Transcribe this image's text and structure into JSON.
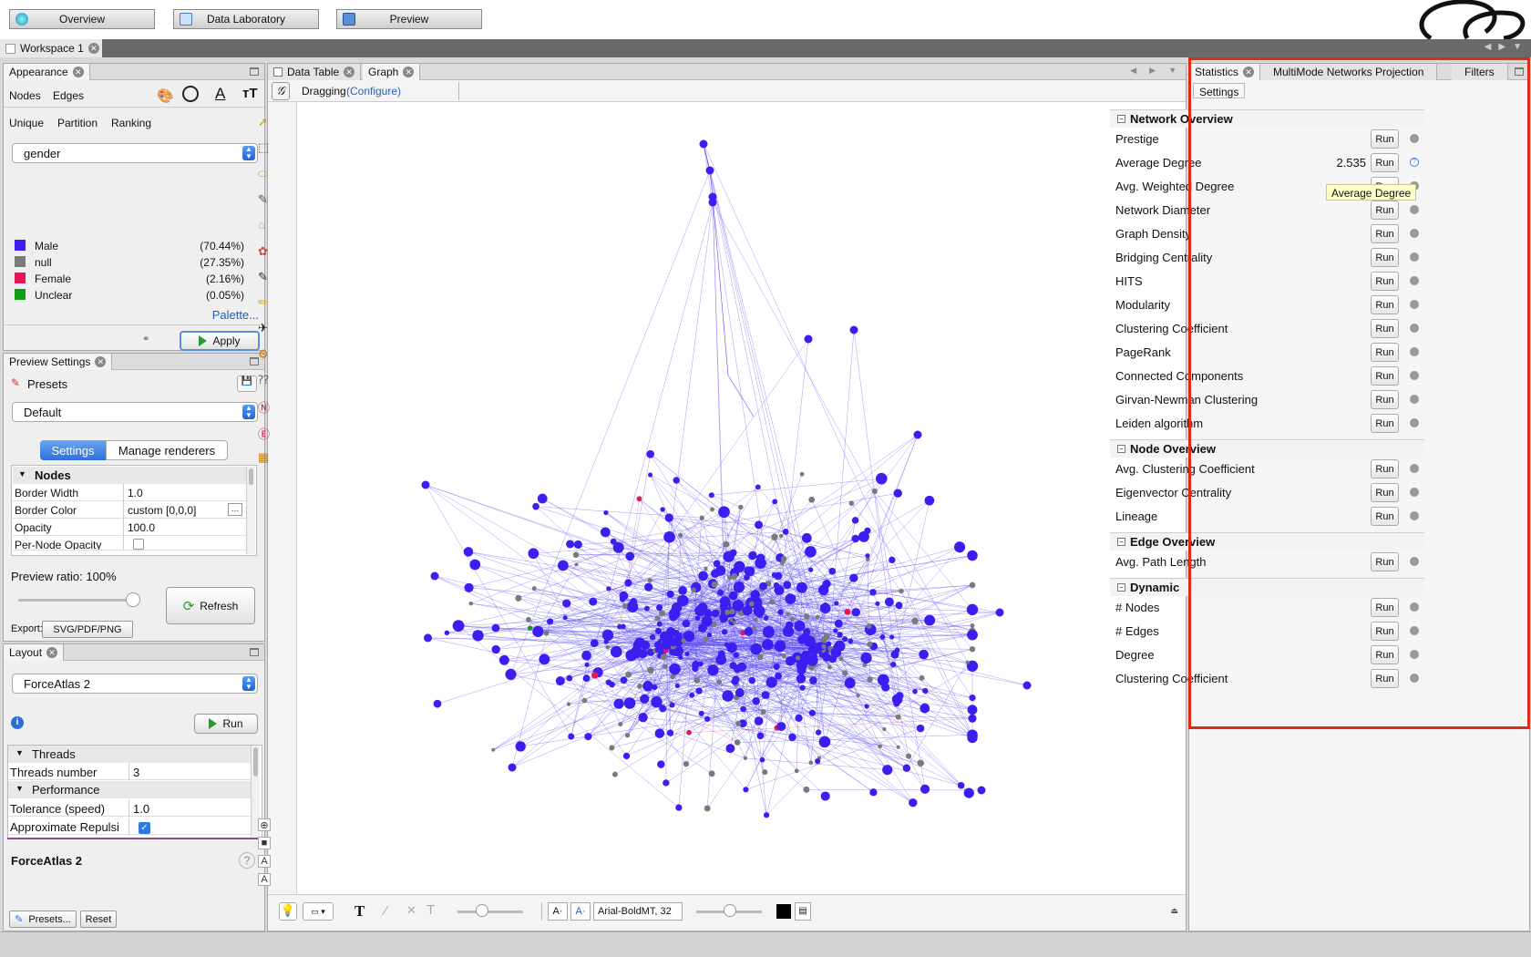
{
  "topbar": {
    "overview": "Overview",
    "data_lab": "Data Laboratory",
    "preview": "Preview"
  },
  "workspace": {
    "tab": "Workspace 1"
  },
  "appearance": {
    "title": "Appearance",
    "nodes": "Nodes",
    "edges": "Edges",
    "modes": [
      "Unique",
      "Partition",
      "Ranking"
    ],
    "attribute": "gender",
    "legend": [
      {
        "label": "Male",
        "pct": "(70.44%)",
        "color": "#3b1ff0"
      },
      {
        "label": "null",
        "pct": "(27.35%)",
        "color": "#7a7a7a"
      },
      {
        "label": "Female",
        "pct": "(2.16%)",
        "color": "#e8145a"
      },
      {
        "label": "Unclear",
        "pct": "(0.05%)",
        "color": "#12a012"
      }
    ],
    "palette": "Palette...",
    "apply": "Apply"
  },
  "preview_settings": {
    "title": "Preview Settings",
    "presets": "Presets",
    "preset_value": "Default",
    "tab_settings": "Settings",
    "tab_renderers": "Manage renderers",
    "group_nodes": "Nodes",
    "props": [
      {
        "k": "Border Width",
        "v": "1.0"
      },
      {
        "k": "Border Color",
        "v": "custom [0,0,0]"
      },
      {
        "k": "Opacity",
        "v": "100.0"
      },
      {
        "k": "Per-Node Opacity",
        "v": ""
      }
    ],
    "ratio_label": "Preview ratio:",
    "ratio_value": "100%",
    "ratio": 1.0,
    "refresh": "Refresh",
    "export_label": "Export:",
    "export_value": "SVG/PDF/PNG"
  },
  "layout": {
    "title": "Layout",
    "algorithm": "ForceAtlas 2",
    "run": "Run",
    "group_threads": "Threads",
    "threads_label": "Threads number",
    "threads_value": "3",
    "group_perf": "Performance",
    "tol_label": "Tolerance (speed)",
    "tol_value": "1.0",
    "approx_label": "Approximate Repulsi",
    "approx_checked": true,
    "desc_title": "ForceAtlas 2",
    "presets": "Presets...",
    "reset": "Reset"
  },
  "graph": {
    "tab_datatable": "Data Table",
    "tab_graph": "Graph",
    "mode": "Dragging",
    "configure": "(Configure)",
    "font": "Arial-BoldMT, 32"
  },
  "statistics": {
    "tab_stats": "Statistics",
    "tab_multimode": "MultiMode Networks Projection",
    "tab_filters": "Filters",
    "settings": "Settings",
    "run": "Run",
    "tooltip": "Average Degree",
    "sections": [
      {
        "title": "Network Overview",
        "items": [
          {
            "name": "Prestige",
            "value": ""
          },
          {
            "name": "Average Degree",
            "value": "2.535"
          },
          {
            "name": "Avg. Weighted Degree",
            "value": ""
          },
          {
            "name": "Network Diameter",
            "value": ""
          },
          {
            "name": "Graph Density",
            "value": ""
          },
          {
            "name": "Bridging Centrality",
            "value": ""
          },
          {
            "name": "HITS",
            "value": ""
          },
          {
            "name": "Modularity",
            "value": ""
          },
          {
            "name": "Clustering Coefficient",
            "value": ""
          },
          {
            "name": "PageRank",
            "value": ""
          },
          {
            "name": "Connected Components",
            "value": ""
          },
          {
            "name": "Girvan-Newman Clustering",
            "value": ""
          },
          {
            "name": "Leiden algorithm",
            "value": ""
          }
        ]
      },
      {
        "title": "Node Overview",
        "items": [
          {
            "name": "Avg. Clustering Coefficient",
            "value": ""
          },
          {
            "name": "Eigenvector Centrality",
            "value": ""
          },
          {
            "name": "Lineage",
            "value": ""
          }
        ]
      },
      {
        "title": "Edge Overview",
        "items": [
          {
            "name": "Avg. Path Length",
            "value": ""
          }
        ]
      },
      {
        "title": "Dynamic",
        "items": [
          {
            "name": "# Nodes",
            "value": ""
          },
          {
            "name": "# Edges",
            "value": ""
          },
          {
            "name": "Degree",
            "value": ""
          },
          {
            "name": "Clustering Coefficient",
            "value": ""
          }
        ]
      }
    ]
  }
}
